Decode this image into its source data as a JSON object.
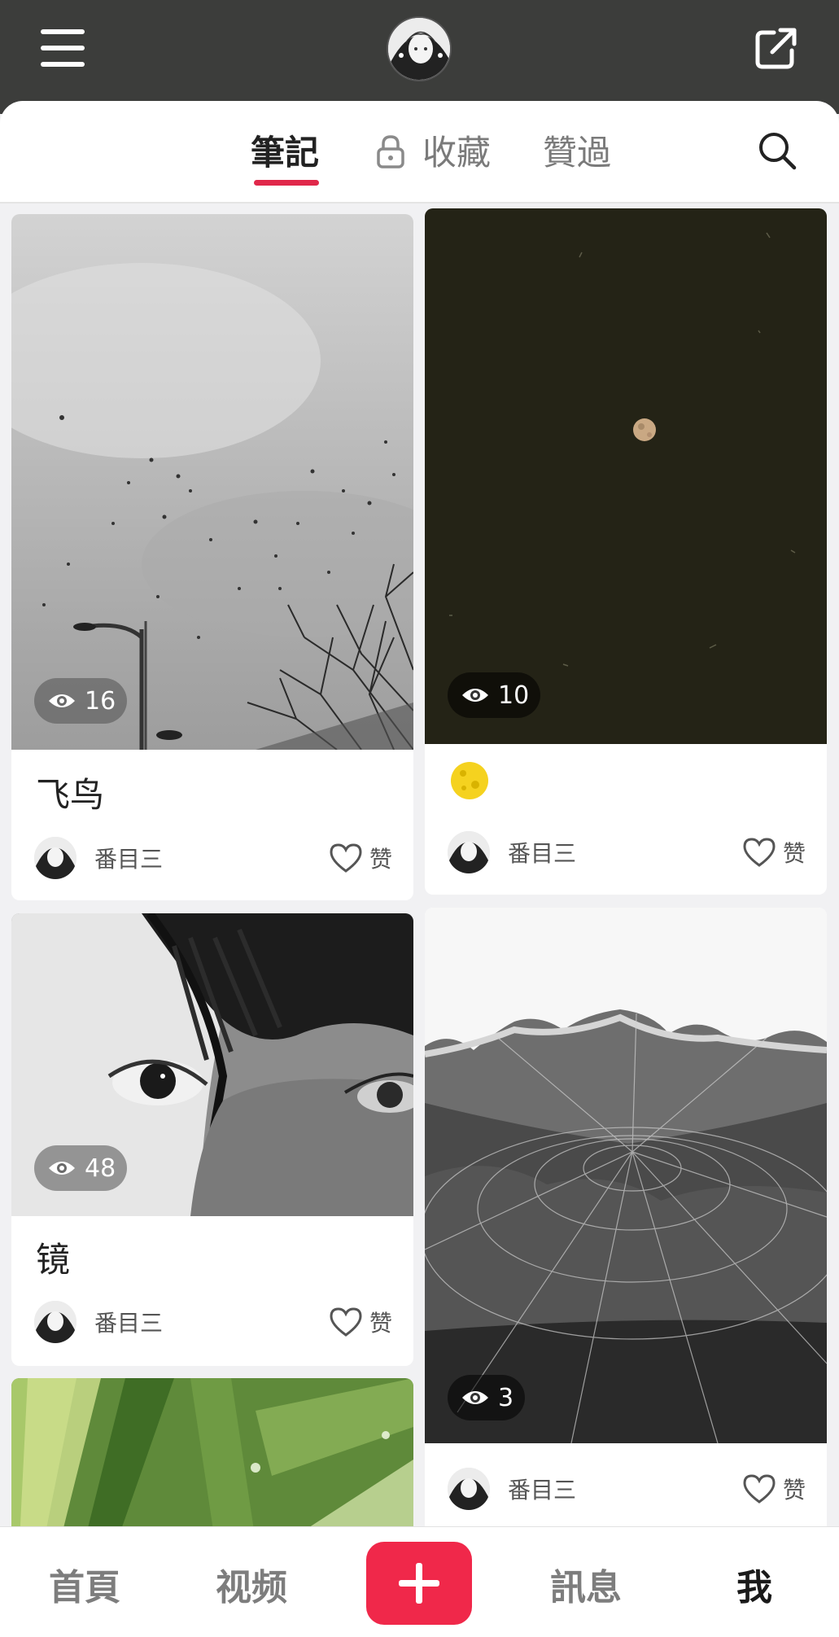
{
  "tabs": [
    {
      "label": "筆記",
      "active": true
    },
    {
      "label": "收藏",
      "locked": true
    },
    {
      "label": "贊過"
    }
  ],
  "posts": [
    {
      "title": "飞鸟",
      "views": "16",
      "author": "番目三",
      "like_label": "赞",
      "image": "grey sky with flying birds, street lamp and bare branches"
    },
    {
      "title": "🌕",
      "views": "10",
      "author": "番目三",
      "like_label": "赞",
      "image": "dark night sky with a small moon"
    },
    {
      "title": "镜",
      "views": "48",
      "author": "番目三",
      "like_label": "赞",
      "image": "black and white close-up of eyes and hair"
    },
    {
      "title": "",
      "views": "3",
      "author": "番目三",
      "like_label": "赞",
      "image": "black and white spider web with wavy rim"
    },
    {
      "title": "",
      "views": "",
      "author": "",
      "like_label": "",
      "image": "green plant leaves with water droplets"
    }
  ],
  "bottom_nav": {
    "home": "首頁",
    "video": "视频",
    "messages": "訊息",
    "me": "我"
  },
  "colors": {
    "accent": "#f0284a",
    "topbar": "#3c3d3b"
  }
}
